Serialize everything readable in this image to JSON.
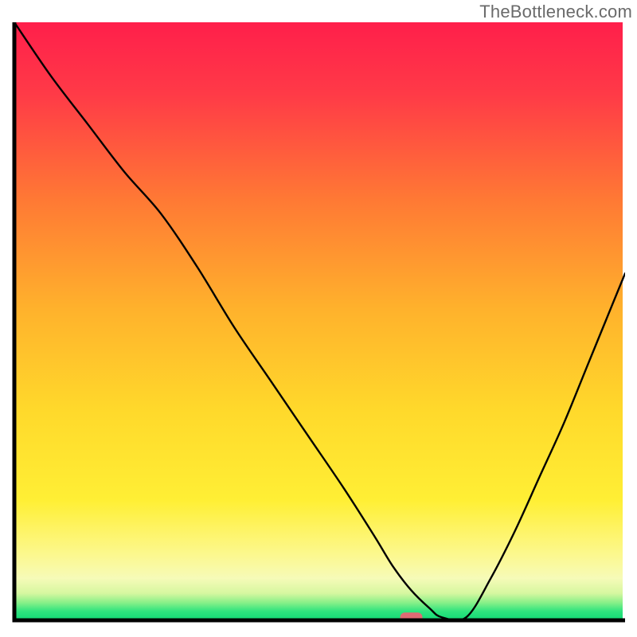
{
  "watermark": "TheBottleneck.com",
  "colors": {
    "gradient_top": "#ff1f4b",
    "gradient_mid1": "#ff8a2a",
    "gradient_mid2": "#ffe22e",
    "gradient_pale": "#fdf9a5",
    "gradient_green": "#15e07a",
    "curve": "#000000",
    "marker_fill": "#e06a74",
    "axis": "#000000"
  },
  "chart_data": {
    "type": "line",
    "title": "",
    "xlabel": "",
    "ylabel": "",
    "xlim": [
      0,
      100
    ],
    "ylim": [
      0,
      100
    ],
    "series": [
      {
        "name": "bottleneck-curve",
        "x": [
          0,
          6,
          12,
          18,
          24,
          30,
          36,
          42,
          48,
          54,
          59,
          62,
          65,
          68,
          70,
          74,
          78,
          82,
          86,
          90,
          94,
          98,
          100
        ],
        "y": [
          100,
          91,
          83,
          75,
          68,
          59,
          49,
          40,
          31,
          22,
          14,
          9,
          5,
          2,
          0.5,
          0.5,
          7,
          15,
          24,
          33,
          43,
          53,
          58
        ]
      }
    ],
    "marker": {
      "x": 65,
      "y": 0.5
    },
    "annotations": []
  }
}
